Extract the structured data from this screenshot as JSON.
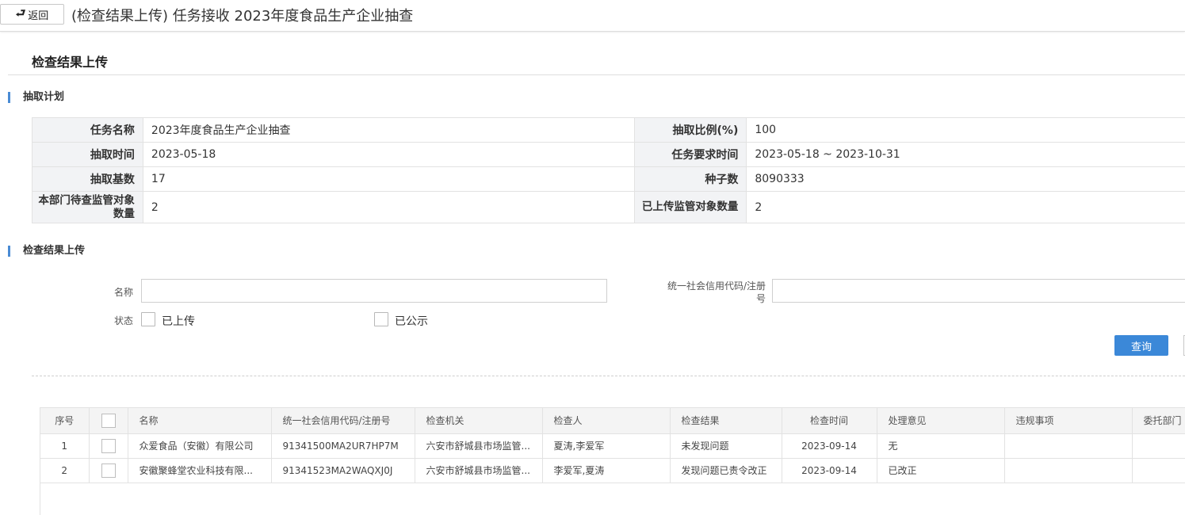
{
  "topbar": {
    "back_label": "返回",
    "title": "(检查结果上传) 任务接收 2023年度食品生产企业抽查"
  },
  "section_title": "检查结果上传",
  "plan": {
    "heading": "抽取计划",
    "rows": [
      {
        "l1": "任务名称",
        "v1": "2023年度食品生产企业抽查",
        "l2": "抽取比例(%)",
        "v2": "100"
      },
      {
        "l1": "抽取时间",
        "v1": "2023-05-18",
        "l2": "任务要求时间",
        "v2": "2023-05-18 ~ 2023-10-31"
      },
      {
        "l1": "抽取基数",
        "v1": "17",
        "l2": "种子数",
        "v2": "8090333"
      },
      {
        "l1": "本部门待查监管对象数量",
        "v1": "2",
        "l2": "已上传监管对象数量",
        "v2": "2"
      }
    ]
  },
  "upload": {
    "heading": "检查结果上传",
    "name_label": "名称",
    "name_value": "",
    "code_label": "统一社会信用代码/注册号",
    "code_value": "",
    "status_label": "状态",
    "status_opt1": "已上传",
    "status_opt2": "已公示",
    "query_label": "查询"
  },
  "grid": {
    "headers": [
      "序号",
      "",
      "名称",
      "统一社会信用代码/注册号",
      "检查机关",
      "检查人",
      "检查结果",
      "检查时间",
      "处理意见",
      "违规事项",
      "委托部门"
    ],
    "rows": [
      [
        "1",
        "",
        "众爱食品（安徽）有限公司",
        "91341500MA2UR7HP7M",
        "六安市舒城县市场监管...",
        "夏涛,李爱军",
        "未发现问题",
        "2023-09-14",
        "无",
        "",
        ""
      ],
      [
        "2",
        "",
        "安徽聚蜂堂农业科技有限...",
        "91341523MA2WAQXJ0J",
        "六安市舒城县市场监管...",
        "李爱军,夏涛",
        "发现问题已责令改正",
        "2023-09-14",
        "已改正",
        "",
        ""
      ]
    ]
  },
  "colors": {
    "accent": "#3b88d8",
    "section_bar": "#4a8bd4",
    "label_bg": "#f2f3f5"
  }
}
